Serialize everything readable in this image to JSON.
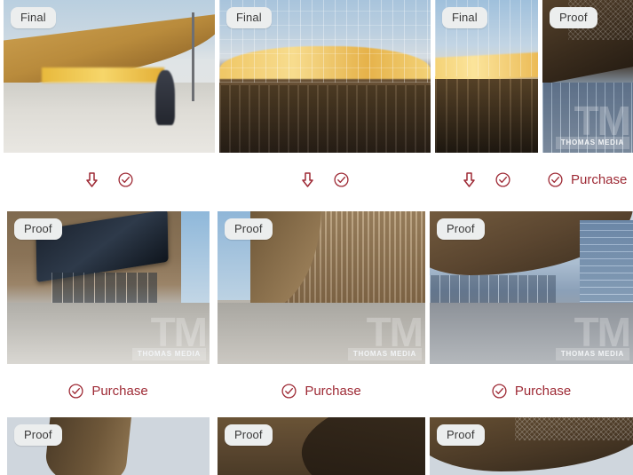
{
  "colors": {
    "accent_red": "#9e2a35",
    "badge_bg": "#eceeee",
    "badge_text": "#3a3a3a",
    "page_bg": "#ffffff"
  },
  "labels": {
    "status_final": "Final",
    "status_proof": "Proof",
    "purchase": "Purchase",
    "watermark_big": "TM",
    "watermark_bar": "THOMAS MEDIA"
  },
  "icons": {
    "download": "download-arrow-icon",
    "approve": "circled-check-icon"
  },
  "rows": [
    {
      "tiles": [
        {
          "status": "Final",
          "watermark": false,
          "actions": [
            {
              "icon": "download-arrow-icon",
              "label": ""
            },
            {
              "icon": "circled-check-icon",
              "label": ""
            }
          ]
        },
        {
          "status": "Final",
          "watermark": false,
          "actions": [
            {
              "icon": "download-arrow-icon",
              "label": ""
            },
            {
              "icon": "circled-check-icon",
              "label": ""
            }
          ]
        },
        {
          "status": "Final",
          "watermark": false,
          "actions": [
            {
              "icon": "download-arrow-icon",
              "label": ""
            },
            {
              "icon": "circled-check-icon",
              "label": ""
            }
          ]
        },
        {
          "status": "Proof",
          "watermark": true,
          "actions": [
            {
              "icon": "circled-check-icon",
              "label": "Purchase"
            }
          ]
        }
      ]
    },
    {
      "tiles": [
        {
          "status": "Proof",
          "watermark": true,
          "actions": [
            {
              "icon": "circled-check-icon",
              "label": "Purchase"
            }
          ]
        },
        {
          "status": "Proof",
          "watermark": true,
          "actions": [
            {
              "icon": "circled-check-icon",
              "label": "Purchase"
            }
          ]
        },
        {
          "status": "Proof",
          "watermark": true,
          "actions": [
            {
              "icon": "circled-check-icon",
              "label": "Purchase"
            }
          ]
        }
      ]
    },
    {
      "tiles": [
        {
          "status": "Proof",
          "watermark": false,
          "actions": []
        },
        {
          "status": "Proof",
          "watermark": false,
          "actions": []
        },
        {
          "status": "Proof",
          "watermark": false,
          "actions": []
        }
      ]
    }
  ]
}
